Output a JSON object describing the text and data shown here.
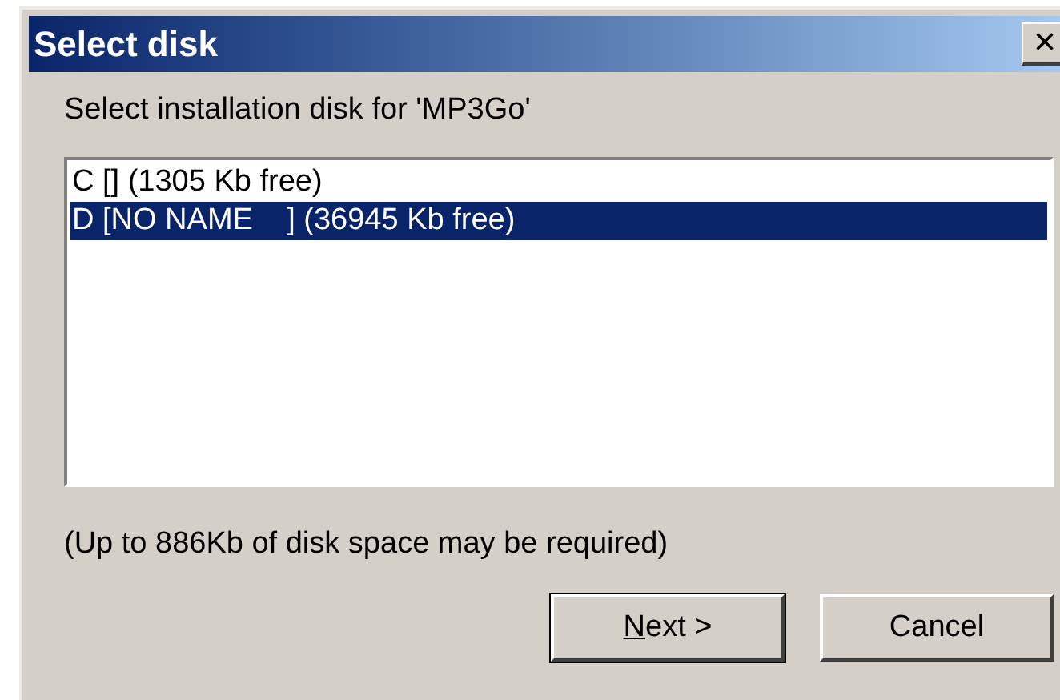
{
  "window": {
    "title": "Select disk",
    "close": "×"
  },
  "prompt": "Select installation disk for 'MP3Go'",
  "disks": [
    {
      "label": "C [] (1305 Kb free)",
      "selected": false
    },
    {
      "label": "D [NO NAME    ] (36945 Kb free)",
      "selected": true
    }
  ],
  "note": "(Up to 886Kb of disk space may be required)",
  "buttons": [
    {
      "label_parts": [
        {
          "text": "N",
          "underlined": true
        },
        {
          "text": "ext >",
          "underlined": false
        }
      ],
      "default": true
    },
    {
      "label_parts": [
        {
          "text": "Cancel",
          "underlined": false
        }
      ],
      "default": false
    }
  ]
}
